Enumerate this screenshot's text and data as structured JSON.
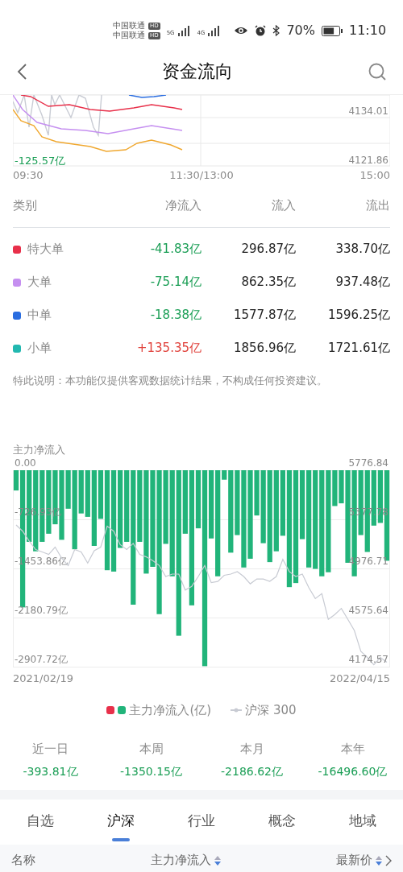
{
  "status_bar": {
    "carriers": [
      "中国联通",
      "中国联通"
    ],
    "hd": [
      "HD",
      "HD"
    ],
    "networks": [
      "5G",
      "4G"
    ],
    "battery": "70%",
    "time": "11:10"
  },
  "header": {
    "title": "资金流向"
  },
  "intraday": {
    "left_label": "-125.57亿",
    "right_labels": [
      "4134.01",
      "4121.86"
    ],
    "x_labels": [
      "09:30",
      "11:30/13:00",
      "15:00"
    ]
  },
  "flow_table": {
    "columns": [
      "类别",
      "净流入",
      "流入",
      "流出"
    ],
    "rows": [
      {
        "name": "特大单",
        "color": "#e8304a",
        "net": {
          "text": "-41.83亿",
          "color": "#1a9e55"
        },
        "inflow": "296.87亿",
        "outflow": "338.70亿"
      },
      {
        "name": "大单",
        "color": "#c58ff0",
        "net": {
          "text": "-75.14亿",
          "color": "#1a9e55"
        },
        "inflow": "862.35亿",
        "outflow": "937.48亿"
      },
      {
        "name": "中单",
        "color": "#2a6de0",
        "net": {
          "text": "-18.38亿",
          "color": "#1a9e55"
        },
        "inflow": "1577.87亿",
        "outflow": "1596.25亿"
      },
      {
        "name": "小单",
        "color": "#22b8b0",
        "net": {
          "text": "+135.35亿",
          "color": "#e0403a"
        },
        "inflow": "1856.96亿",
        "outflow": "1721.61亿"
      }
    ]
  },
  "disclaimer": "特此说明：本功能仅提供客观数据统计结果，不构成任何投资建议。",
  "main_flow": {
    "title": "主力净流入",
    "chart_data": {
      "type": "bar",
      "grid": true,
      "ylim": [
        -2907.72,
        0
      ],
      "yticks": [
        {
          "value": 0,
          "label": "0.00"
        },
        {
          "value": -726.93,
          "label": "-726.93亿"
        },
        {
          "value": -1453.86,
          "label": "-1453.86亿"
        },
        {
          "value": -2180.79,
          "label": "-2180.79亿"
        },
        {
          "value": -2907.72,
          "label": "-2907.72亿"
        }
      ],
      "series": [
        {
          "name": "主力净流入(亿)",
          "color": "#21b47a",
          "values": [
            -300,
            -2030,
            -1060,
            -1200,
            -1060,
            -940,
            -800,
            -1030,
            -570,
            -1170,
            -640,
            -690,
            -1120,
            -720,
            -1480,
            -1500,
            -1150,
            -1060,
            -1990,
            -1060,
            -1530,
            -1430,
            -2130,
            -1090,
            -1570,
            -2450,
            -940,
            -2000,
            -860,
            -2900,
            -1010,
            -1570,
            -140,
            -1220,
            -960,
            -1440,
            -1310,
            -670,
            -1080,
            -1360,
            -1200,
            -970,
            -1730,
            -1670,
            -1020,
            -1440,
            -1460,
            -1570,
            -1510,
            -530,
            -490,
            -1370,
            -1570,
            -960,
            -1210,
            -820,
            -780,
            -1340
          ]
        }
      ]
    },
    "index_chart": {
      "chart_data": {
        "type": "line",
        "ylim": [
          4174.57,
          5776.84
        ],
        "yticks": [
          {
            "value": 5776.84,
            "label": "5776.84"
          },
          {
            "value": 5377.78,
            "label": "5377.78"
          },
          {
            "value": 4976.71,
            "label": "4976.71"
          },
          {
            "value": 4575.64,
            "label": "4575.64"
          },
          {
            "value": 4174.57,
            "label": "4174.57"
          }
        ],
        "series": [
          {
            "name": "沪深 300",
            "color": "#c8cbd3",
            "values": [
              5330,
              5280,
              5200,
              5130,
              5110,
              5090,
              5150,
              5060,
              5000,
              5130,
              5110,
              5020,
              5120,
              5150,
              5320,
              5280,
              5170,
              5130,
              5180,
              5090,
              5070,
              5040,
              5000,
              4910,
              4930,
              4930,
              4800,
              4830,
              4910,
              5000,
              4860,
              4870,
              4920,
              4930,
              4950,
              4910,
              4850,
              4890,
              4890,
              4870,
              4910,
              5050,
              4950,
              4910,
              4930,
              4820,
              4730,
              4770,
              4560,
              4600,
              4650,
              4560,
              4470,
              4300,
              4250,
              4190,
              4250,
              4210
            ]
          }
        ]
      }
    },
    "date_range": [
      "2021/02/19",
      "2022/04/15"
    ],
    "legend_swatches": [
      {
        "color": "#e8304a"
      },
      {
        "color": "#21b47a"
      }
    ]
  },
  "summary": [
    {
      "label": "近一日",
      "value": "-393.81亿"
    },
    {
      "label": "本周",
      "value": "-1350.15亿"
    },
    {
      "label": "本月",
      "value": "-2186.62亿"
    },
    {
      "label": "本年",
      "value": "-16496.60亿"
    }
  ],
  "tabs": [
    {
      "label": "自选",
      "selected": false
    },
    {
      "label": "沪深",
      "selected": true
    },
    {
      "label": "行业",
      "selected": false
    },
    {
      "label": "概念",
      "selected": false
    },
    {
      "label": "地域",
      "selected": false
    }
  ],
  "list_header": [
    {
      "label": "名称",
      "sortable": false
    },
    {
      "label": "主力净流入",
      "sortable": true
    },
    {
      "label": "最新价",
      "sortable": true,
      "more": true
    }
  ]
}
